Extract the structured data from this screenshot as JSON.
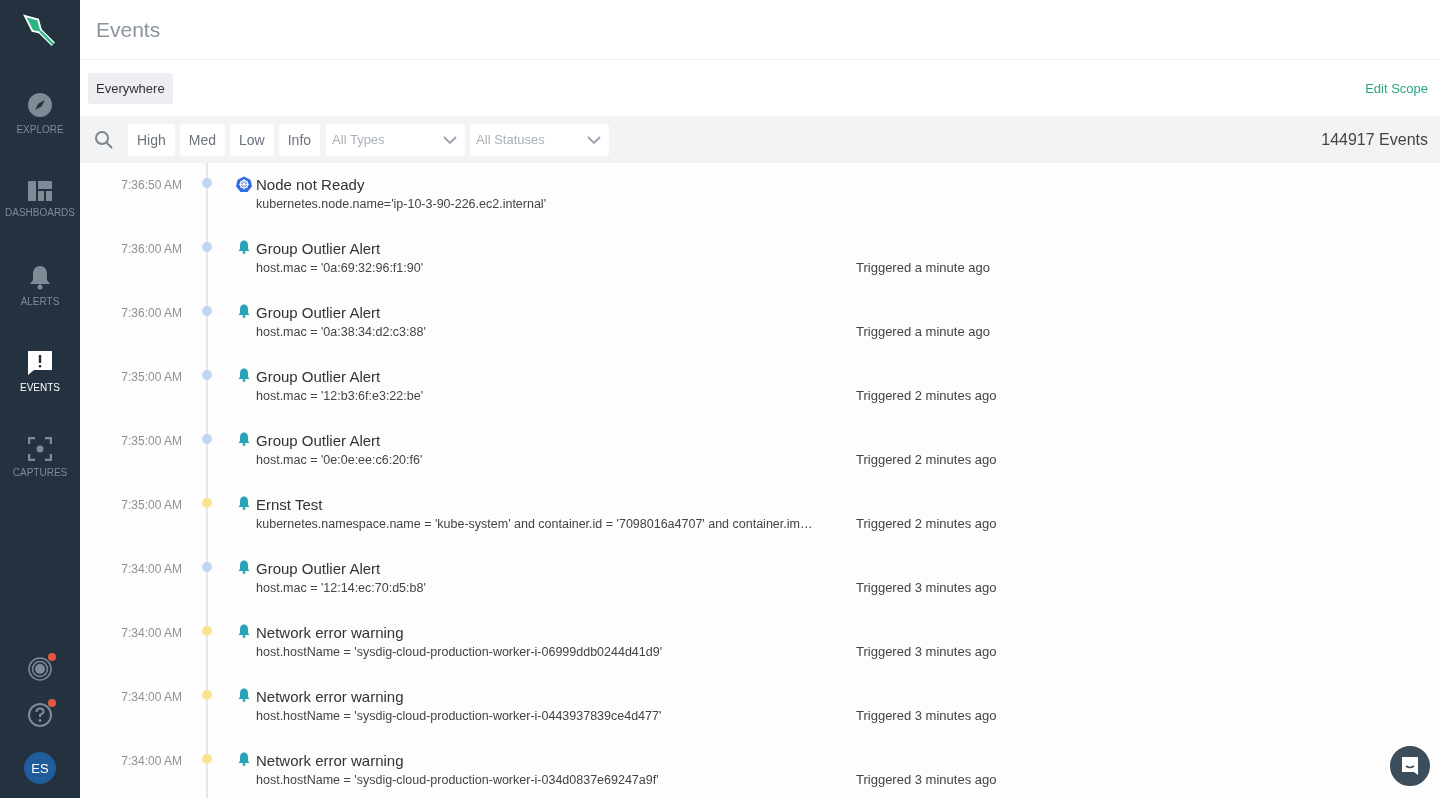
{
  "sidebar": {
    "items": [
      {
        "label": "EXPLORE",
        "kind": "compass",
        "selected": false
      },
      {
        "label": "DASHBOARDS",
        "kind": "dashboard",
        "selected": false
      },
      {
        "label": "ALERTS",
        "kind": "bell",
        "selected": false
      },
      {
        "label": "EVENTS",
        "kind": "events",
        "selected": true
      },
      {
        "label": "CAPTURES",
        "kind": "capture",
        "selected": false
      }
    ],
    "bottom": [
      {
        "kind": "radar",
        "notification": true
      },
      {
        "kind": "help",
        "notification": true
      }
    ],
    "avatar": "ES"
  },
  "header": {
    "title": "Events"
  },
  "scope": {
    "label": "Everywhere",
    "action": "Edit Scope"
  },
  "filters": {
    "severities": [
      {
        "label": "High",
        "selected": false
      },
      {
        "label": "Med",
        "selected": false
      },
      {
        "label": "Low",
        "selected": false
      },
      {
        "label": "Info",
        "selected": false
      }
    ],
    "dropdowns": [
      {
        "placeholder": "All Types"
      },
      {
        "placeholder": "All Statuses"
      }
    ],
    "count": "144917 Events"
  },
  "events": [
    {
      "time": "7:36:50 AM",
      "color": "#c3d6ef",
      "kind": "kubernetes",
      "title": "Node not Ready",
      "detail": "kubernetes.node.name='ip-10-3-90-226.ec2.internal'"
    },
    {
      "time": "7:36:00 AM",
      "color": "#c3d6ef",
      "kind": "alert",
      "title": "Group Outlier Alert",
      "detail": "host.mac = '0a:69:32:96:f1:90'",
      "status": "Triggered a minute ago"
    },
    {
      "time": "7:36:00 AM",
      "color": "#c3d6ef",
      "kind": "alert",
      "title": "Group Outlier Alert",
      "detail": "host.mac = '0a:38:34:d2:c3:88'",
      "status": "Triggered a minute ago"
    },
    {
      "time": "7:35:00 AM",
      "color": "#c3d6ef",
      "kind": "alert",
      "title": "Group Outlier Alert",
      "detail": "host.mac = '12:b3:6f:e3:22:be'",
      "status": "Triggered 2 minutes ago"
    },
    {
      "time": "7:35:00 AM",
      "color": "#c3d6ef",
      "kind": "alert",
      "title": "Group Outlier Alert",
      "detail": "host.mac = '0e:0e:ee:c6:20:f6'",
      "status": "Triggered 2 minutes ago"
    },
    {
      "time": "7:35:00 AM",
      "color": "#f8e38f",
      "kind": "alert",
      "title": "Ernst Test",
      "detail": "kubernetes.namespace.name = 'kube-system' and container.id = '7098016a4707' and container.im…",
      "status": "Triggered 2 minutes ago"
    },
    {
      "time": "7:34:00 AM",
      "color": "#c3d6ef",
      "kind": "alert",
      "title": "Group Outlier Alert",
      "detail": "host.mac = '12:14:ec:70:d5:b8'",
      "status": "Triggered 3 minutes ago"
    },
    {
      "time": "7:34:00 AM",
      "color": "#f8e38f",
      "kind": "alert",
      "title": "Network error warning",
      "detail": "host.hostName = 'sysdig-cloud-production-worker-i-06999ddb0244d41d9'",
      "status": "Triggered 3 minutes ago"
    },
    {
      "time": "7:34:00 AM",
      "color": "#f8e38f",
      "kind": "alert",
      "title": "Network error warning",
      "detail": "host.hostName = 'sysdig-cloud-production-worker-i-0443937839ce4d477'",
      "status": "Triggered 3 minutes ago"
    },
    {
      "time": "7:34:00 AM",
      "color": "#f8e38f",
      "kind": "alert",
      "title": "Network error warning",
      "detail": "host.hostName = 'sysdig-cloud-production-worker-i-034d0837e69247a9f'",
      "status": "Triggered 3 minutes ago"
    }
  ]
}
